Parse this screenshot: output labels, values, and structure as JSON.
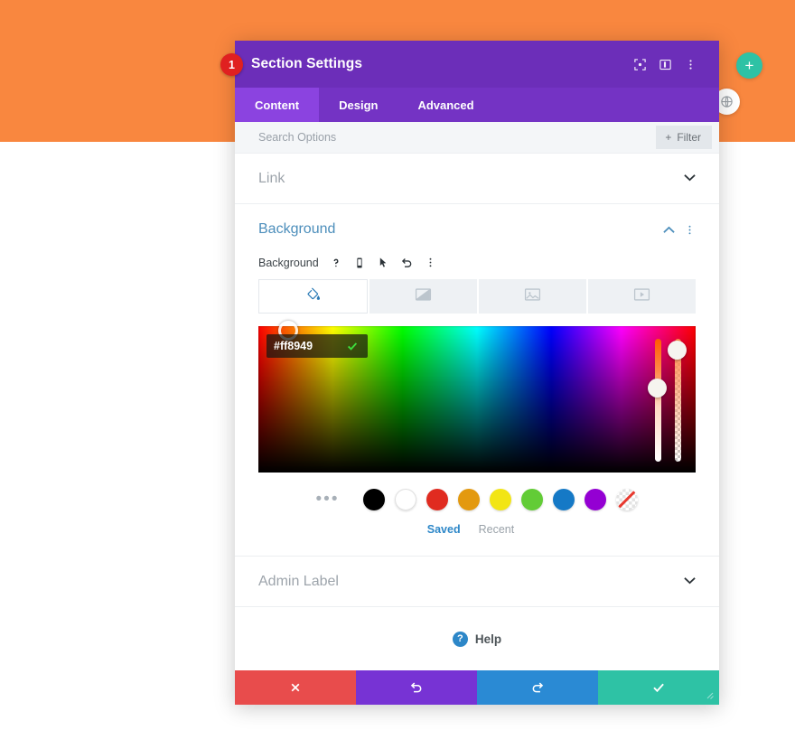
{
  "page": {
    "background_color": "#ffffff",
    "hero_band_color": "#f9873f"
  },
  "floating_controls": {
    "add_section_label": "+",
    "globe_icon": "globe-icon"
  },
  "modal": {
    "title": "Section Settings",
    "header_icons": [
      {
        "name": "focus-target-icon",
        "glyph": "⬚"
      },
      {
        "name": "panel-layout-icon",
        "glyph": "▧"
      },
      {
        "name": "overflow-menu-icon",
        "glyph": "⋮"
      }
    ],
    "tabs": [
      {
        "label": "Content",
        "active": true
      },
      {
        "label": "Design",
        "active": false
      },
      {
        "label": "Advanced",
        "active": false
      }
    ],
    "search": {
      "placeholder": "Search Options",
      "value": ""
    },
    "filter_button": {
      "plus": "+",
      "label": "Filter"
    },
    "sections": {
      "link": {
        "title": "Link",
        "expanded": false,
        "chevron": "⌄"
      },
      "background": {
        "title": "Background",
        "expanded": true,
        "collapse_chevron": "⌃",
        "menu_glyph": "⋮",
        "field_label": "Background",
        "field_icons": [
          {
            "name": "help-question-icon",
            "glyph": "?"
          },
          {
            "name": "responsive-mobile-icon",
            "glyph": "▯"
          },
          {
            "name": "hover-cursor-icon",
            "glyph": "➤"
          },
          {
            "name": "reset-undo-icon",
            "glyph": "↺"
          },
          {
            "name": "field-overflow-menu-icon",
            "glyph": "⋮"
          }
        ],
        "type_tabs": [
          {
            "name": "background-color-tab",
            "icon": "paint-bucket-icon",
            "active": true
          },
          {
            "name": "background-gradient-tab",
            "icon": "gradient-icon",
            "active": false
          },
          {
            "name": "background-image-tab",
            "icon": "image-icon",
            "active": false
          },
          {
            "name": "background-video-tab",
            "icon": "video-icon",
            "active": false
          }
        ],
        "color_picker": {
          "hex_value": "#ff8949",
          "confirm_glyph": "✓",
          "hue_slider_name": "hue-slider",
          "alpha_slider_name": "alpha-slider",
          "more_swatches_glyph": "•••",
          "swatches": [
            {
              "name": "swatch-black",
              "color": "#000000"
            },
            {
              "name": "swatch-white",
              "color": "#ffffff"
            },
            {
              "name": "swatch-red",
              "color": "#e02b20"
            },
            {
              "name": "swatch-orange",
              "color": "#e3990f"
            },
            {
              "name": "swatch-yellow",
              "color": "#f2e515"
            },
            {
              "name": "swatch-green",
              "color": "#62cc36"
            },
            {
              "name": "swatch-blue",
              "color": "#1579c6"
            },
            {
              "name": "swatch-purple",
              "color": "#9400d3"
            },
            {
              "name": "swatch-transparent",
              "color": "transparent"
            }
          ],
          "palette_tabs": [
            {
              "label": "Saved",
              "active": true
            },
            {
              "label": "Recent",
              "active": false
            }
          ]
        }
      },
      "admin_label": {
        "title": "Admin Label",
        "expanded": false,
        "chevron": "⌄"
      }
    },
    "help": {
      "icon_glyph": "?",
      "label": "Help"
    },
    "footer_buttons": [
      {
        "name": "cancel-button",
        "glyph": "✕",
        "color": "#e84c4c"
      },
      {
        "name": "undo-button",
        "glyph": "↺",
        "color": "#7733d4"
      },
      {
        "name": "redo-button",
        "glyph": "↻",
        "color": "#2a8ad4"
      },
      {
        "name": "save-button",
        "glyph": "✓",
        "color": "#2ec2a5"
      }
    ],
    "resize_handle_glyph": "⤡"
  },
  "annotations": {
    "step_1": "1"
  }
}
